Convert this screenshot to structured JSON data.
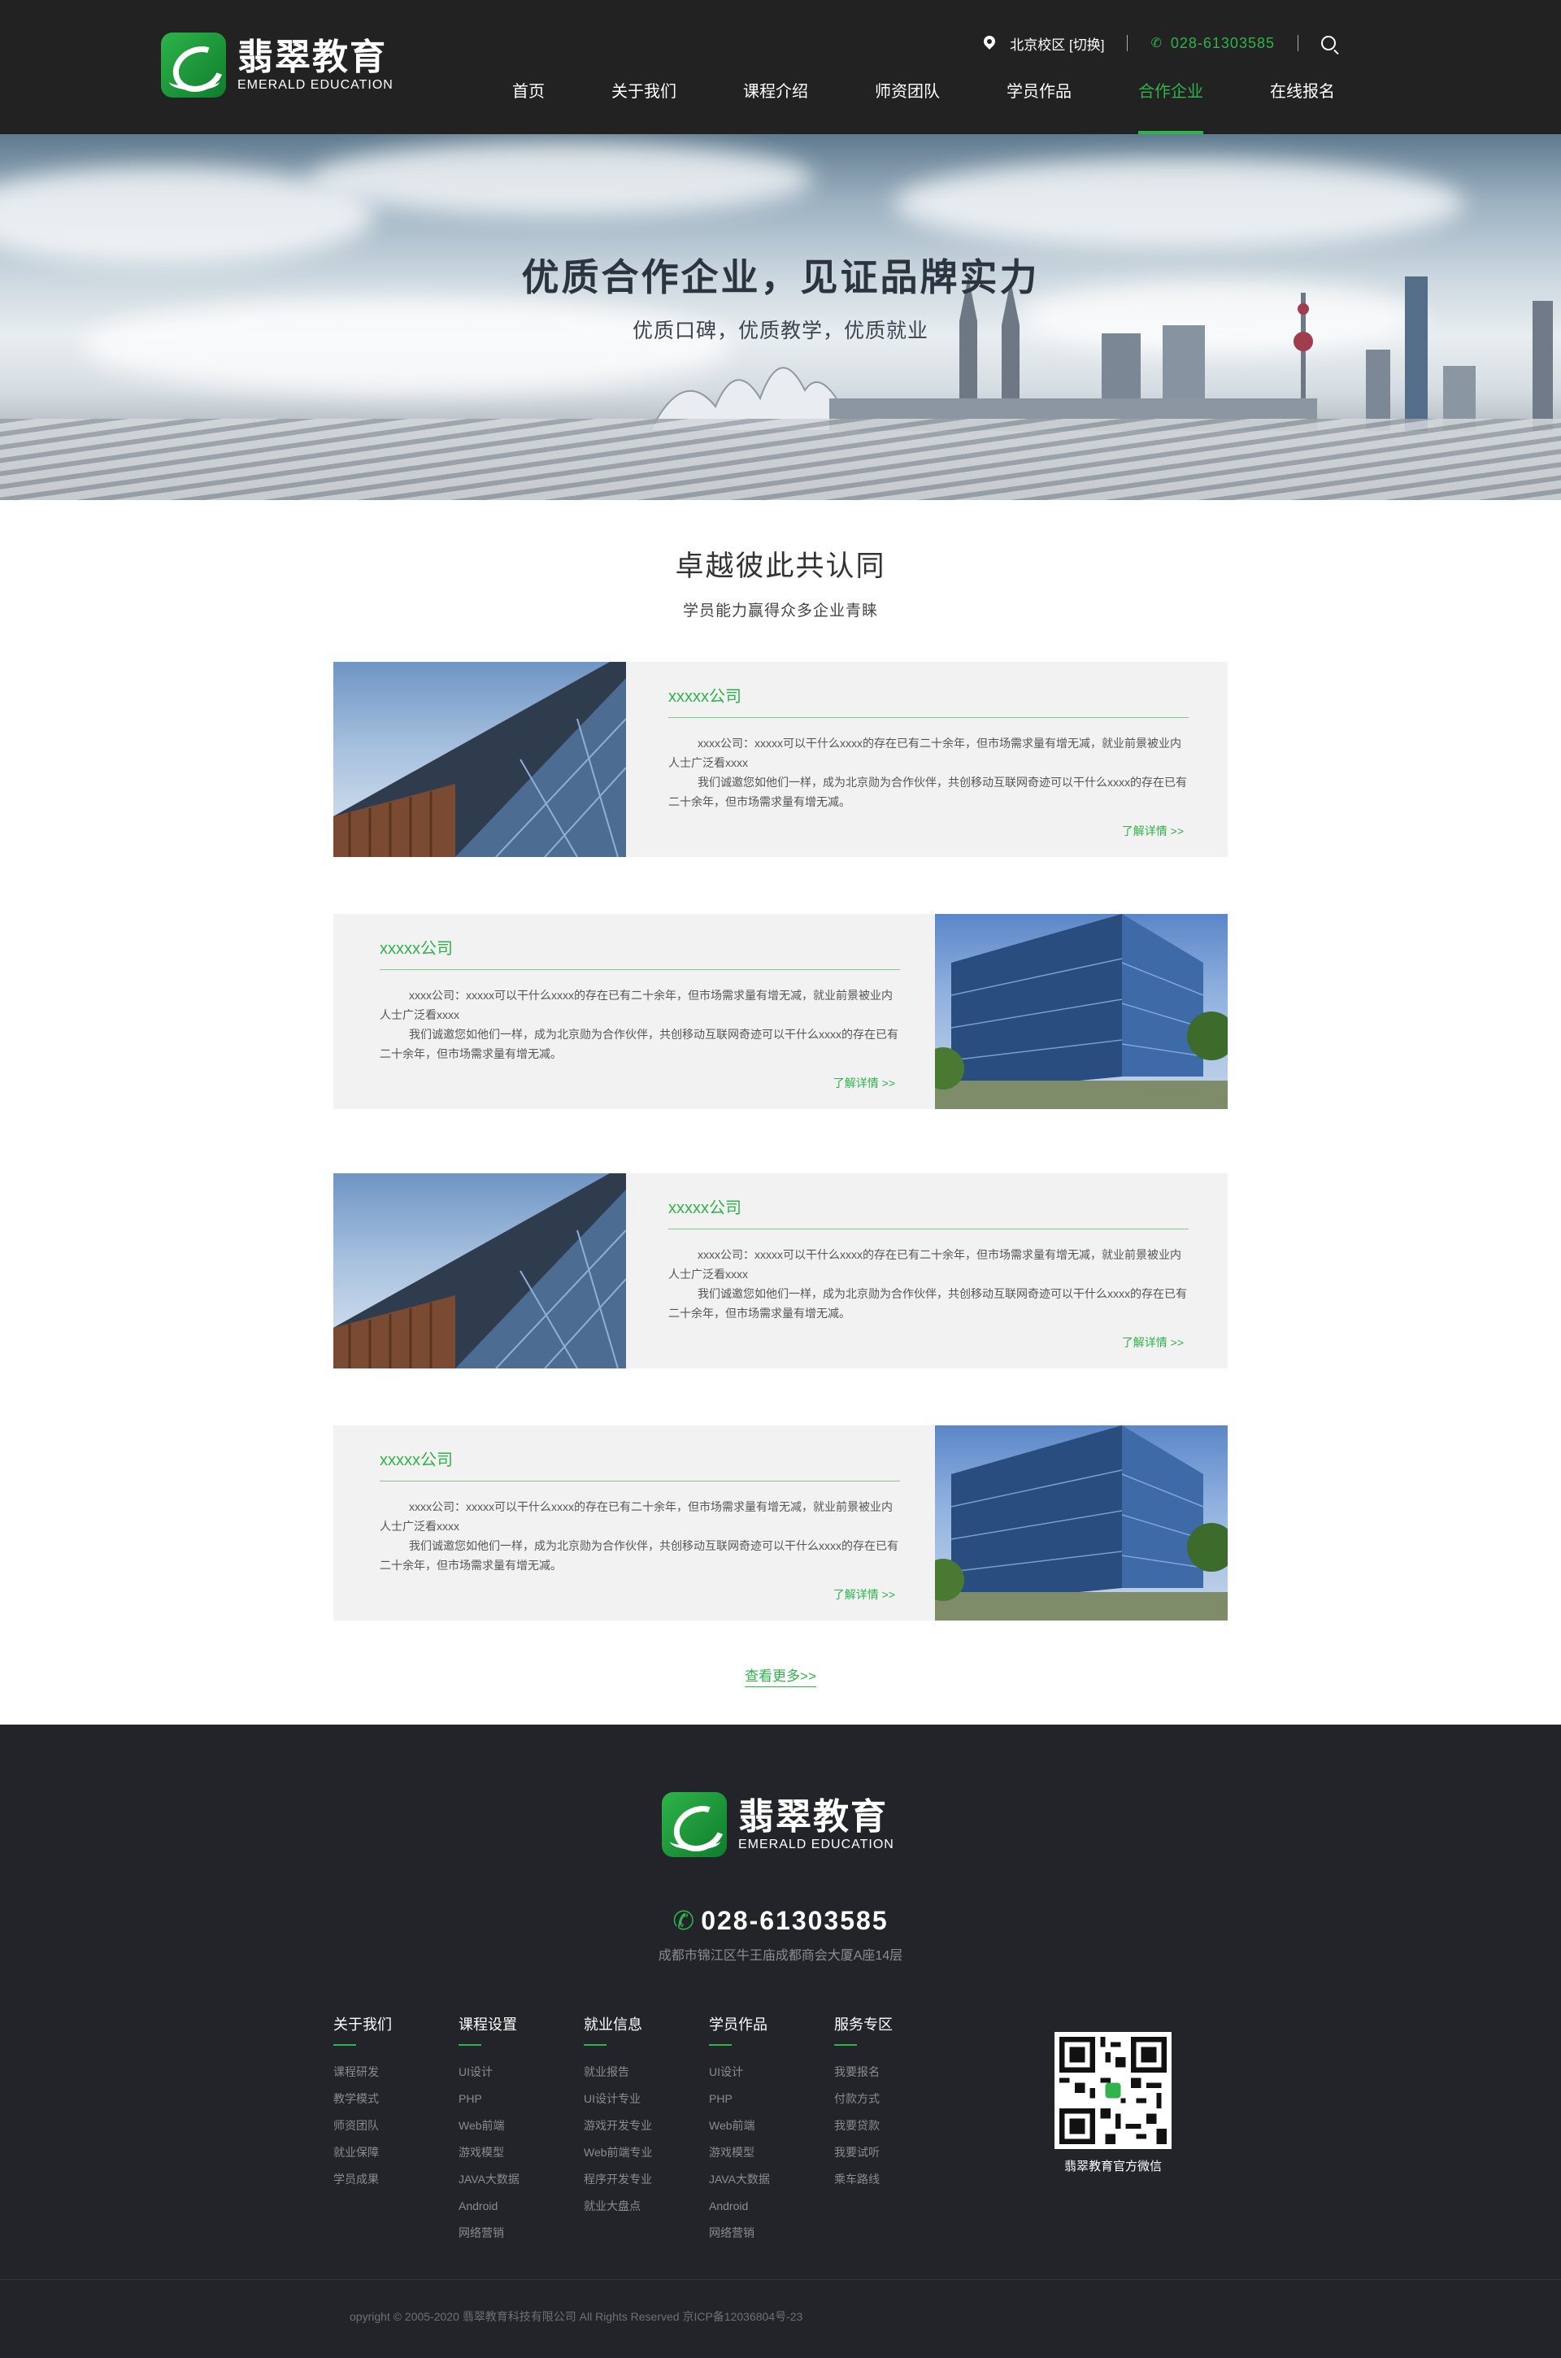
{
  "brand": {
    "name_cn": "翡翠教育",
    "name_en": "EMERALD  EDUCATION"
  },
  "topbar": {
    "campus": "北京校区 [切换]",
    "phone": "028-61303585"
  },
  "nav": {
    "items": [
      {
        "label": "首页",
        "active": false
      },
      {
        "label": "关于我们",
        "active": false
      },
      {
        "label": "课程介绍",
        "active": false
      },
      {
        "label": "师资团队",
        "active": false
      },
      {
        "label": "学员作品",
        "active": false
      },
      {
        "label": "合作企业",
        "active": true
      },
      {
        "label": "在线报名",
        "active": false
      }
    ]
  },
  "banner": {
    "title": "优质合作企业，见证品牌实力",
    "subtitle": "优质口碑，优质教学，优质就业"
  },
  "section": {
    "title": "卓越彼此共认同",
    "subtitle": "学员能力赢得众多企业青睐"
  },
  "cards": [
    {
      "title": "xxxxx公司",
      "p1": "xxxx公司：xxxxx可以干什么xxxx的存在已有二十余年，但市场需求量有增无减，就业前景被业内人士广泛看xxxx",
      "p2": "我们诚邀您如他们一样，成为北京勋为合作伙伴，共创移动互联网奇迹可以干什么xxxx的存在已有二十余年，但市场需求量有增无减。",
      "more": "了解详情 >>",
      "image": "glass-building"
    },
    {
      "title": "xxxxx公司",
      "p1": "xxxx公司：xxxxx可以干什么xxxx的存在已有二十余年，但市场需求量有增无减，就业前景被业内人士广泛看xxxx",
      "p2": "我们诚邀您如他们一样，成为北京勋为合作伙伴，共创移动互联网奇迹可以干什么xxxx的存在已有二十余年，但市场需求量有增无减。",
      "more": "了解详情 >>",
      "image": "office-building"
    },
    {
      "title": "xxxxx公司",
      "p1": "xxxx公司：xxxxx可以干什么xxxx的存在已有二十余年，但市场需求量有增无减，就业前景被业内人士广泛看xxxx",
      "p2": "我们诚邀您如他们一样，成为北京勋为合作伙伴，共创移动互联网奇迹可以干什么xxxx的存在已有二十余年，但市场需求量有增无减。",
      "more": "了解详情 >>",
      "image": "glass-building"
    },
    {
      "title": "xxxxx公司",
      "p1": "xxxx公司：xxxxx可以干什么xxxx的存在已有二十余年，但市场需求量有增无减，就业前景被业内人士广泛看xxxx",
      "p2": "我们诚邀您如他们一样，成为北京勋为合作伙伴，共创移动互联网奇迹可以干什么xxxx的存在已有二十余年，但市场需求量有增无减。",
      "more": "了解详情 >>",
      "image": "office-building"
    }
  ],
  "see_more": "查看更多>>",
  "footer": {
    "phone": "028-61303585",
    "address": "成都市锦江区牛王庙成都商会大厦A座14层",
    "columns": [
      {
        "title": "关于我们",
        "links": [
          "课程研发",
          "教学模式",
          "师资团队",
          "就业保障",
          "学员成果"
        ]
      },
      {
        "title": "课程设置",
        "links": [
          "UI设计",
          "PHP",
          "Web前端",
          "游戏模型",
          "JAVA大数据",
          "Android",
          "网络营销"
        ]
      },
      {
        "title": "就业信息",
        "links": [
          "就业报告",
          "UI设计专业",
          "游戏开发专业",
          "Web前端专业",
          "程序开发专业",
          "就业大盘点"
        ]
      },
      {
        "title": "学员作品",
        "links": [
          "UI设计",
          "PHP",
          "Web前端",
          "游戏模型",
          "JAVA大数据",
          "Android",
          "网络营销"
        ]
      },
      {
        "title": "服务专区",
        "links": [
          "我要报名",
          "付款方式",
          "我要贷款",
          "我要试听",
          "乘车路线"
        ]
      }
    ],
    "qr_caption": "翡翠教育官方微信",
    "copyright": "opyright © 2005-2020 翡翠教育科技有限公司 All Rights Reserved 京ICP备12036804号-23"
  },
  "colors": {
    "accent": "#2fb34a",
    "header_bg": "#222222",
    "footer_bg": "#23242a",
    "card_bg": "#f2f2f2"
  }
}
